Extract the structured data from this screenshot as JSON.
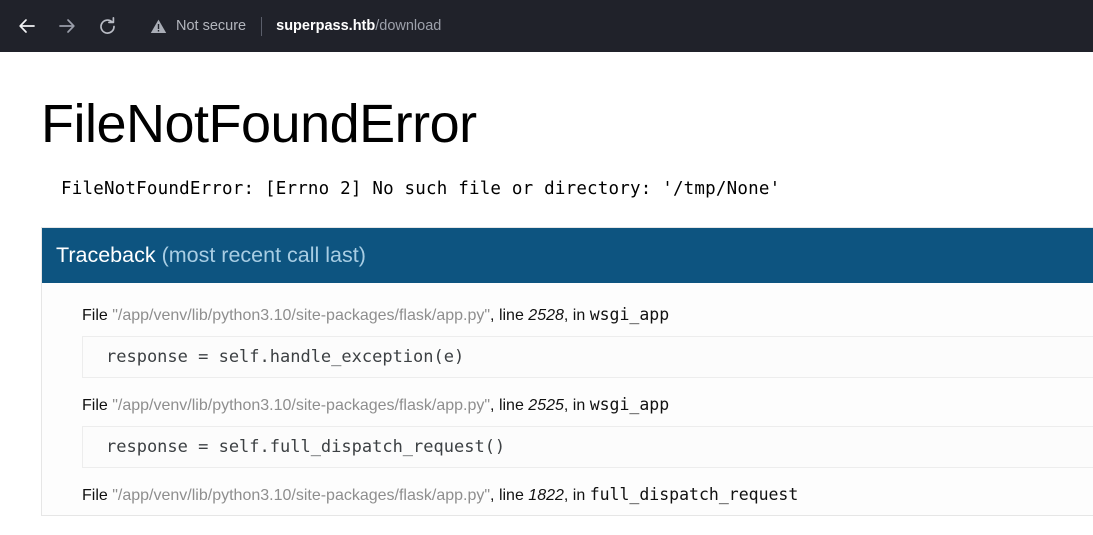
{
  "browser": {
    "back_icon": "arrow-left-icon",
    "forward_icon": "arrow-right-icon",
    "reload_icon": "reload-icon",
    "warning_icon": "warning-triangle-icon",
    "security_label": "Not secure",
    "url_host": "superpass.htb",
    "url_path": "/download",
    "bar_color": "#20222a"
  },
  "page": {
    "title": "FileNotFoundError",
    "error_message": "FileNotFoundError: [Errno 2] No such file or directory: '/tmp/None'"
  },
  "traceback": {
    "heading_main": "Traceback",
    "heading_sub": "(most recent call last)",
    "header_color": "#0d5480",
    "frames": [
      {
        "file_keyword": "File",
        "filename": "\"/app/venv/lib/python3.10/site-packages/flask/app.py\"",
        "line_label": ", line ",
        "line_number": "2528",
        "in_label": ", in ",
        "function": "wsgi_app",
        "code": "response = self.handle_exception(e)"
      },
      {
        "file_keyword": "File",
        "filename": "\"/app/venv/lib/python3.10/site-packages/flask/app.py\"",
        "line_label": ", line ",
        "line_number": "2525",
        "in_label": ", in ",
        "function": "wsgi_app",
        "code": "response = self.full_dispatch_request()"
      },
      {
        "file_keyword": "File",
        "filename": "\"/app/venv/lib/python3.10/site-packages/flask/app.py\"",
        "line_label": ", line ",
        "line_number": "1822",
        "in_label": ", in ",
        "function": "full_dispatch_request",
        "code": ""
      }
    ]
  }
}
